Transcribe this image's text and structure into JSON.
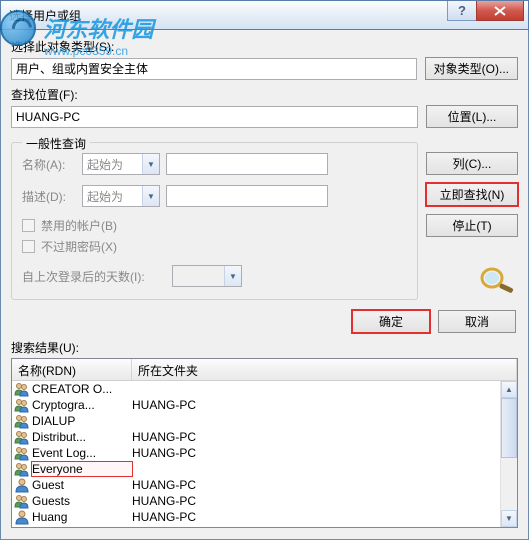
{
  "title": "选择用户或组",
  "watermark": {
    "text": "河东软件园",
    "url": "www.pc0359.cn"
  },
  "section1": {
    "label": "选择此对象类型(S):",
    "value": "用户、组或内置安全主体"
  },
  "section2": {
    "label": "查找位置(F):",
    "value": "HUANG-PC"
  },
  "buttons": {
    "objectTypes": "对象类型(O)...",
    "locations": "位置(L)...",
    "columns": "列(C)...",
    "findNow": "立即查找(N)",
    "stop": "停止(T)",
    "ok": "确定",
    "cancel": "取消"
  },
  "fieldset": {
    "legend": "一般性查询",
    "name": {
      "label": "名称(A):",
      "combo": "起始为"
    },
    "desc": {
      "label": "描述(D):",
      "combo": "起始为"
    },
    "disabledAcct": "禁用的帐户(B)",
    "noExpirePwd": "不过期密码(X)",
    "lastLogon": "自上次登录后的天数(I):"
  },
  "resultsLabel": "搜索结果(U):",
  "columns": {
    "name": "名称(RDN)",
    "folder": "所在文件夹"
  },
  "results": [
    {
      "icon": "group",
      "name": "CREATOR O...",
      "folder": ""
    },
    {
      "icon": "group",
      "name": "Cryptogra...",
      "folder": "HUANG-PC"
    },
    {
      "icon": "group",
      "name": "DIALUP",
      "folder": ""
    },
    {
      "icon": "group",
      "name": "Distribut...",
      "folder": "HUANG-PC"
    },
    {
      "icon": "group",
      "name": "Event Log...",
      "folder": "HUANG-PC"
    },
    {
      "icon": "group",
      "name": "Everyone",
      "folder": "",
      "highlight": true
    },
    {
      "icon": "user",
      "name": "Guest",
      "folder": "HUANG-PC"
    },
    {
      "icon": "group",
      "name": "Guests",
      "folder": "HUANG-PC"
    },
    {
      "icon": "user",
      "name": "Huang",
      "folder": "HUANG-PC"
    }
  ]
}
